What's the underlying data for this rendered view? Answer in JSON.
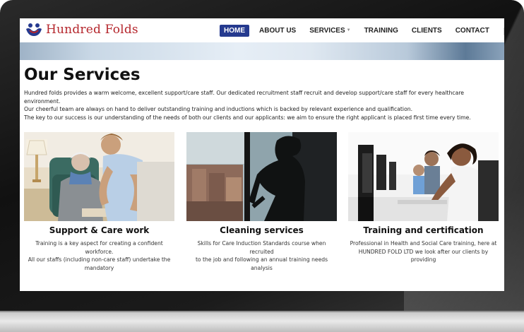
{
  "brand": {
    "name": "Hundred Folds",
    "logo_icon": "people-hands-logo",
    "color": "#b5272d"
  },
  "nav": {
    "items": [
      {
        "label": "HOME",
        "active": true
      },
      {
        "label": "ABOUT US",
        "active": false
      },
      {
        "label": "SERVICES",
        "active": false,
        "has_dropdown": true
      },
      {
        "label": "TRAINING",
        "active": false
      },
      {
        "label": "CLIENTS",
        "active": false
      },
      {
        "label": "CONTACT",
        "active": false
      }
    ],
    "active_color": "#253a8f",
    "search_icon": "search-icon"
  },
  "page": {
    "title": "Our Services",
    "intro": [
      "Hundred folds provides a warm welcome, excellent support/care staff. Our dedicated recruitment staff recruit and develop support/care staff for every healthcare environment.",
      "Our cheerful team are always on hand to deliver outstanding training and inductions which is backed by relevant experience and qualification.",
      "The key to our success is our understanding of the needs of both our clients and our applicants: we aim to ensure the right applicant is placed first time every time."
    ]
  },
  "services": [
    {
      "title": "Support & Care work",
      "desc": [
        "Training is a key aspect for creating a confident workforce.",
        "All our staffs (including non-care staff) undertake the",
        "mandatory"
      ]
    },
    {
      "title": "Cleaning services",
      "desc": [
        "Skills for Care Induction Standards course when recruited",
        "to the job and following an annual training needs analysis"
      ]
    },
    {
      "title": "Training and certification",
      "desc": [
        "Professional in Health and Social Care training, here at",
        "HUNDRED FOLD LTD we look after our clients by providing"
      ]
    }
  ]
}
